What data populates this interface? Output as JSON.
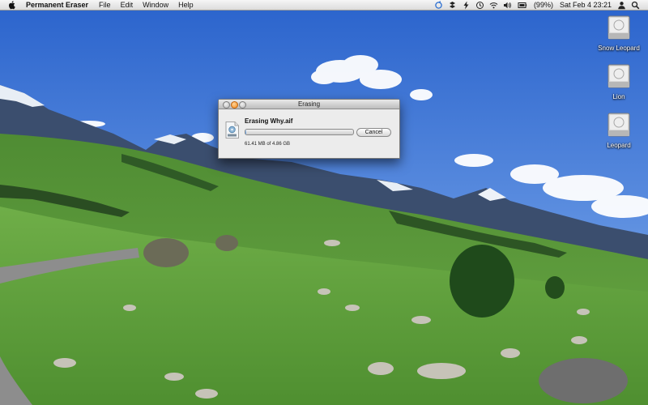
{
  "menubar": {
    "app_name": "Permanent Eraser",
    "menus": [
      "File",
      "Edit",
      "Window",
      "Help"
    ],
    "battery": "(99%)",
    "clock": "Sat Feb 4  23:21",
    "status_icons": [
      "sync-icon",
      "dropbox-icon",
      "bolt-icon",
      "time-machine-icon",
      "wifi-icon",
      "volume-icon",
      "battery-icon"
    ]
  },
  "desktop": {
    "drives": [
      {
        "name": "Snow Leopard",
        "icon": "hard-drive-icon"
      },
      {
        "name": "Lion",
        "icon": "hard-drive-icon"
      },
      {
        "name": "Leopard",
        "icon": "hard-drive-icon"
      }
    ]
  },
  "dialog": {
    "title": "Erasing",
    "status": "Erasing Why.aif",
    "progress": 0.01,
    "size": "61.41 MB of 4.86 GB",
    "cancel_label": "Cancel",
    "file_icon": "audio-file-icon"
  },
  "colors": {
    "sky_top": "#2f6bd2",
    "grass": "#5b9a3a",
    "progress_fill": "#4b8fe0"
  }
}
